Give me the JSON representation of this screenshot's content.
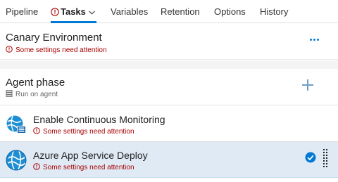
{
  "tabs": [
    {
      "label": "Pipeline",
      "active": false
    },
    {
      "label": "Tasks",
      "active": true,
      "has_warning": true,
      "has_dropdown": true
    },
    {
      "label": "Variables",
      "active": false
    },
    {
      "label": "Retention",
      "active": false
    },
    {
      "label": "Options",
      "active": false
    },
    {
      "label": "History",
      "active": false
    }
  ],
  "environment": {
    "title": "Canary Environment",
    "warning": "Some settings need attention",
    "more_icon": "ellipsis-icon"
  },
  "agent_phase": {
    "title": "Agent phase",
    "subtitle": "Run on agent",
    "add_icon": "plus-icon"
  },
  "tasks": [
    {
      "name": "Enable Continuous Monitoring",
      "warning": "Some settings need attention",
      "selected": false,
      "icon": "monitoring-globe-icon"
    },
    {
      "name": "Azure App Service Deploy",
      "warning": "Some settings need attention",
      "selected": true,
      "icon": "app-service-globe-icon"
    }
  ],
  "colors": {
    "accent": "#0078d4",
    "warning": "#a80000",
    "selected_row": "#dfeaf5"
  }
}
